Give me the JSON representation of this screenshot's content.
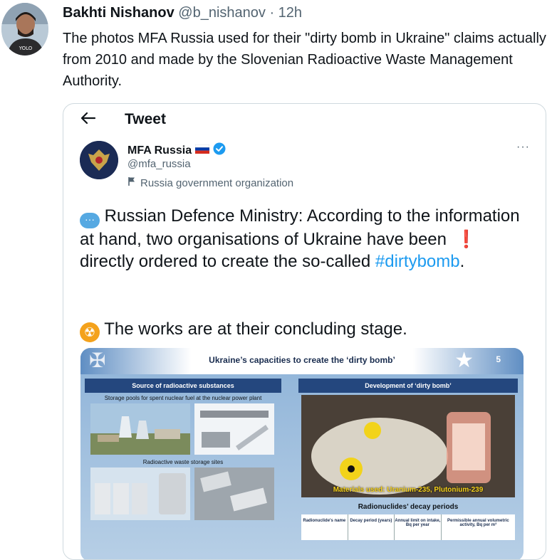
{
  "outer_tweet": {
    "display_name": "Bakhti Nishanov",
    "handle": "@b_nishanov",
    "separator": "·",
    "time": "12h",
    "text": "The photos MFA Russia used for their \"dirty bomb in Ukraine\" claims actually from 2010 and made by the Slovenian Radioactive Waste Management Authority."
  },
  "quoted": {
    "header_title": "Tweet",
    "back_icon": "arrow-left-icon",
    "account": {
      "display_name": "MFA Russia",
      "handle": "@mfa_russia",
      "label": "Russia government organization",
      "verified_color": "#1d9bf0"
    },
    "more_icon": "···",
    "text_part1": "Russian Defence Ministry: According to the information at hand, two organisations of Ukraine have been",
    "excl": "❗",
    "text_part2": "directly ordered to create the so-called",
    "hashtag": "#dirtybomb",
    "period": ".",
    "speech_emoji": "···",
    "rad_emoji": "☢",
    "works_text": "The works are at their concluding stage."
  },
  "slide": {
    "title": "Ukraine’s capacities to create the ‘dirty bomb’",
    "number": "5",
    "left_panel": {
      "heading": "Source of radioactive substances",
      "sub1": "Storage pools for spent nuclear fuel at the nuclear power plant",
      "sub2": "Radioactive waste storage sites"
    },
    "right_panel": {
      "heading": "Development of ‘dirty bomb’",
      "materials": "Materials used: Uranium-235, Plutonium-239",
      "decay_title": "Radionuclides’ decay periods",
      "columns": [
        "Radionuclide's name",
        "Decay period (years)",
        "Annual limit on intake, Bq per year",
        "Permissible annual volumetric activity, Bq per m³"
      ]
    }
  },
  "colors": {
    "text_primary": "#0f1419",
    "text_secondary": "#536471",
    "link": "#1d9bf0",
    "border": "#cfd9de"
  }
}
